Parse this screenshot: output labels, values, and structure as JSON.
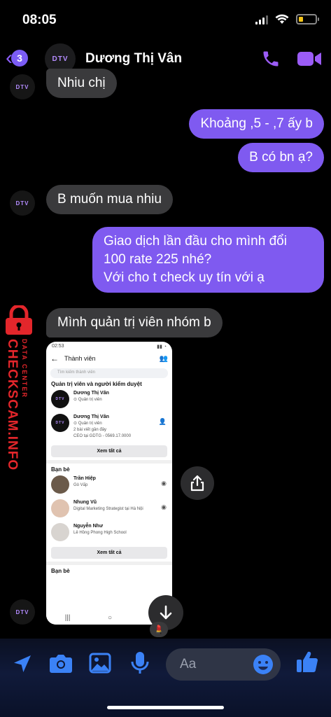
{
  "status_bar": {
    "time": "08:05"
  },
  "header": {
    "back_badge": "3",
    "contact_name": "Dương Thị Vân",
    "avatar_text": "DTV"
  },
  "messages": [
    {
      "side": "in",
      "text": "Nhiu chị"
    },
    {
      "side": "out",
      "text": "Khoảng ,5 - ,7 ấy b"
    },
    {
      "side": "out",
      "text": "B có bn ạ?"
    },
    {
      "side": "in",
      "text": "B muốn mua nhiu"
    },
    {
      "side": "out",
      "lines": [
        "Giao dịch lần đầu cho mình đổi",
        "100 rate 225 nhé?",
        "Với cho t check uy tín với ạ"
      ]
    },
    {
      "side": "in",
      "text": "Mình quản trị viên nhóm b"
    }
  ],
  "watermark": {
    "main": "CHECKSCAM.INFO",
    "sub": "DATA CENTER"
  },
  "embedded_screenshot": {
    "status_time": "02:53",
    "title": "Thành viên",
    "search_placeholder": "Tìm kiếm thành viên",
    "section_admins": "Quản trị viên và người kiểm duyệt",
    "admins": [
      {
        "name": "Dương Thị Vân",
        "role": "Quản trị viên"
      },
      {
        "name": "Dương Thị Vân",
        "role": "Quản trị viên",
        "extra": "2 bài viết gần đây",
        "job": "CEO tại GDTG - 0569.17.0000"
      }
    ],
    "see_all": "Xem tất cả",
    "section_friends": "Bạn bè",
    "friends": [
      {
        "name": "Trần Hiệp",
        "detail": "Gò Vấp"
      },
      {
        "name": "Nhung Vũ",
        "detail": "Digital Marketing Strategist tại Hà Nội"
      },
      {
        "name": "Nguyễn Như",
        "detail": "Lê Hồng Phong High School"
      }
    ],
    "see_all_2": "Xem tất cả",
    "section_friends_2": "Bạn bè",
    "nav": [
      "|||",
      "○",
      "<"
    ]
  },
  "composer": {
    "placeholder": "Aa"
  },
  "colors": {
    "accent": "#7f5af0",
    "incoming": "#3a3a3c",
    "watermark": "#e3262b"
  }
}
